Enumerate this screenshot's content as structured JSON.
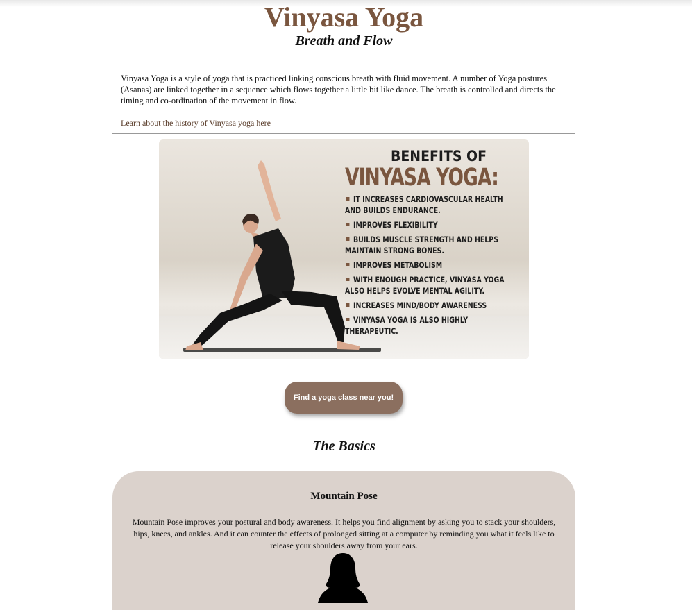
{
  "header": {
    "title": "Vinyasa Yoga",
    "subtitle": "Breath and Flow"
  },
  "intro": {
    "text": "Vinyasa Yoga is a style of yoga that is practiced linking conscious breath with fluid movement. A number of Yoga postures (Asanas) are linked together in a sequence which flows together a little bit like dance. The breath is controlled and directs the timing and co-ordination of the movement in flow.",
    "history_link": "Learn about the history of Vinyasa yoga here"
  },
  "banner": {
    "heading_line1": "BENEFITS OF",
    "heading_line2": "VINYASA YOGA:",
    "benefits": [
      "IT INCREASES CARDIOVASCULAR HEALTH AND BUILDS ENDURANCE.",
      "IMPROVES FLEXIBILITY",
      "BUILDS MUSCLE STRENGTH AND HELPS MAINTAIN STRONG BONES.",
      "IMPROVES METABOLISM",
      "WITH ENOUGH PRACTICE, VINYASA YOGA ALSO HELPS EVOLVE MENTAL AGILITY.",
      "INCREASES MIND/BODY AWARENESS",
      "VINYASA YOGA IS ALSO HIGHLY THERAPEUTIC."
    ]
  },
  "cta": {
    "label": "Find a yoga class near you!"
  },
  "basics": {
    "heading": "The Basics",
    "cards": [
      {
        "title": "Mountain Pose",
        "text": "Mountain Pose improves your postural and body awareness. It helps you find alignment by asking you to stack your shoulders, hips, knees, and ankles. And it can counter the effects of prolonged sitting at a computer by reminding you what it feels like to release your shoulders away from your ears."
      }
    ]
  },
  "colors": {
    "brand_brown": "#7a563f",
    "button_bg": "#8b6f5f",
    "card_bg": "#dbd2cc"
  }
}
